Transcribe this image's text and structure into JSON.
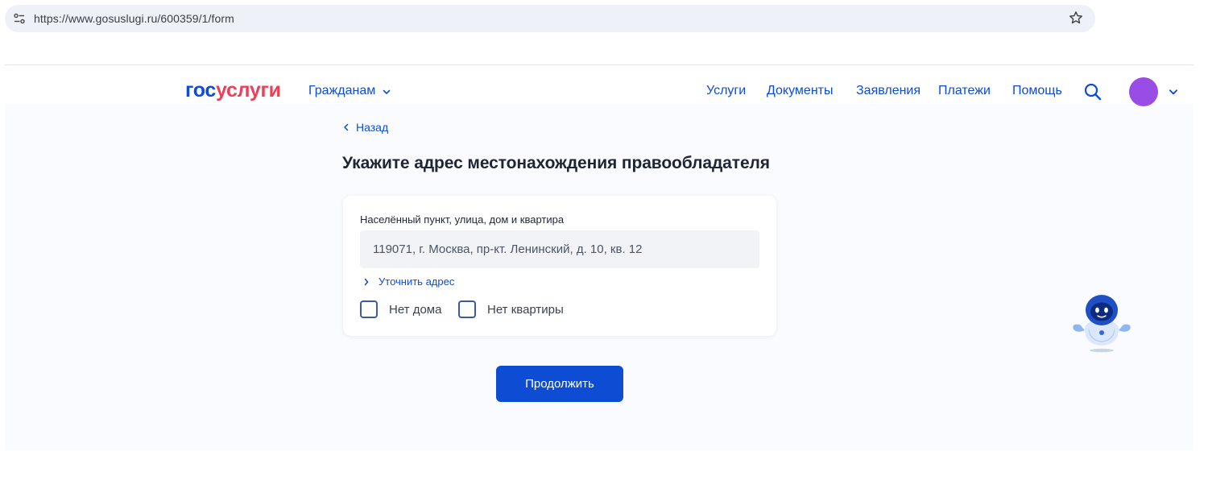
{
  "browser": {
    "url": "https://www.gosuslugi.ru/600359/1/form"
  },
  "header": {
    "logo_part1": "гос",
    "logo_part2": "услуги",
    "citizens_label": "Гражданам",
    "nav": [
      "Услуги",
      "Документы",
      "Заявления",
      "Платежи",
      "Помощь"
    ]
  },
  "form": {
    "back_label": "Назад",
    "title": "Укажите адрес местонахождения правообладателя",
    "address_label": "Населённый пункт, улица, дом и квартира",
    "address_value": "119071, г. Москва, пр-кт. Ленинский, д. 10, кв. 12",
    "refine_label": "Уточнить адрес",
    "no_house_label": "Нет дома",
    "no_flat_label": "Нет квартиры",
    "continue_label": "Продолжить"
  },
  "colors": {
    "brand_blue": "#0d4cd3",
    "brand_red": "#ee3f58",
    "avatar": "#9a4ce6",
    "page_bg": "#fafbfe"
  },
  "icons": [
    "site-info-icon",
    "star-icon",
    "chevron-down-icon",
    "search-icon",
    "chevron-left-icon",
    "chevron-right-icon",
    "assistant-robot-icon"
  ]
}
